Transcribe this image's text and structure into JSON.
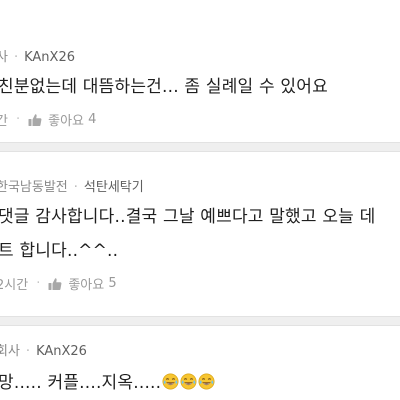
{
  "comments": [
    {
      "affiliation": "사",
      "nickname": "KAnX26",
      "lines": [
        "친분없는데 대뜸하는건... 좀 실례일 수 있어요"
      ],
      "time": "간",
      "like_label": "좋아요",
      "like_count": "4"
    },
    {
      "affiliation": "한국남동발전",
      "nickname": "석탄세탁기",
      "lines": [
        "댓글 감사합니다..결국 그날 예쁘다고 말했고 오늘 데",
        "트 합니다..^^.."
      ],
      "time": "2시간",
      "like_label": "좋아요",
      "like_count": "5"
    },
    {
      "affiliation": "회사",
      "nickname": "KAnX26",
      "lines": [
        "망..... 커플....지옥....."
      ],
      "emoji_count": 3,
      "emoji_name": "tears-of-joy-emoji"
    }
  ],
  "colors": {
    "meta_text": "#8a8a8a",
    "body_text": "#1f1f1f",
    "divider": "#efefef",
    "emoji_face": "#f7c531"
  }
}
